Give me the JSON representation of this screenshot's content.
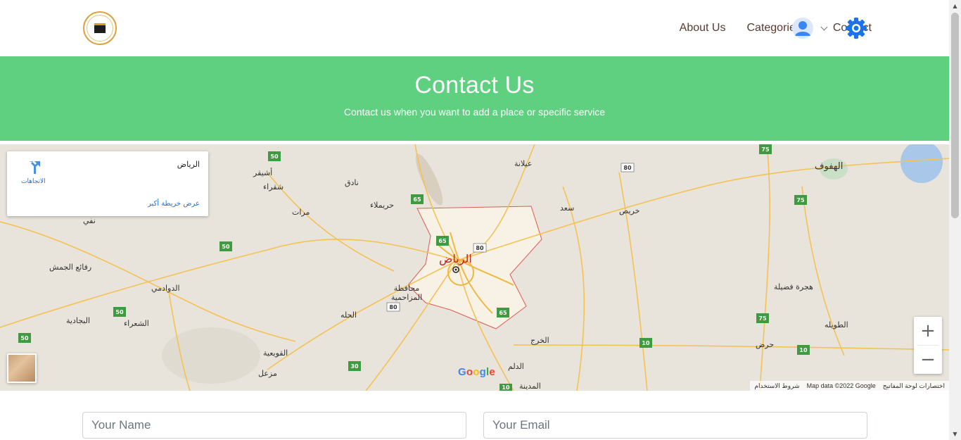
{
  "nav": {
    "about": "About Us",
    "categories": "Categories",
    "contact": "Contact"
  },
  "hero": {
    "title": "Contact Us",
    "subtitle": "Contact us when you want to add a place or specific service"
  },
  "map": {
    "place_name": "الرياض",
    "directions_label": "الاتجاهات",
    "bigger_map_label": "عرض خريطة أكبر",
    "zoom_in": "+",
    "zoom_out": "−",
    "google_logo": "Google",
    "attribution": {
      "shortcuts": "اختصارات لوحة المفاتيح",
      "map_data": "Map data ©2022 Google",
      "terms": "شروط الاستخدام"
    },
    "city_labels": {
      "riyadh": "الرياض",
      "hofuf": "الهفوف",
      "aldawadmi": "الدوادمي",
      "alshaara": "الشعراء",
      "albijadiya": "البجادية",
      "rafaie": "رفائع الجمش",
      "nafi": "نفي",
      "ushaiqer": "أشيقر",
      "shaqra": "شقراء",
      "nadiq": "نادق",
      "marat": "مرات",
      "huraymila": "حريملاء",
      "ailana": "عيلانة",
      "sad": "سعد",
      "harees": "خريص",
      "almuzahimiyah": "محافظة المزاحمية",
      "alhilah": "الحله",
      "alkharj": "الخرج",
      "aldelam": "الدلم",
      "almadina": "المدينة",
      "alquwaiyah": "القويعية",
      "muzal": "مزعل",
      "hajrat_fadila": "هجرة فضيلة",
      "altawila": "الطويله",
      "harad": "حرض"
    },
    "route_shields": [
      "50",
      "65",
      "80",
      "75",
      "30",
      "10"
    ]
  },
  "form": {
    "name_placeholder": "Your Name",
    "email_placeholder": "Your Email"
  },
  "colors": {
    "hero_bg": "#5fcf80",
    "nav_text": "#5b3a2e",
    "link_blue": "#1a73e8",
    "gear_blue": "#1a73e8"
  }
}
